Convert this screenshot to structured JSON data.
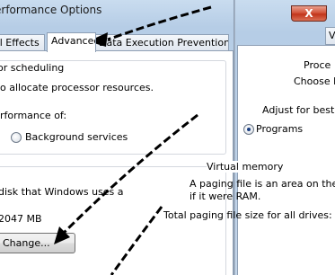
{
  "left_dialog": {
    "title": "erformance Options",
    "tabs": [
      {
        "label": "al Effects",
        "active": false
      },
      {
        "label": "Advanced",
        "active": true
      },
      {
        "label": "Data Execution Prevention",
        "active": false
      }
    ],
    "scheduling": {
      "heading": "or scheduling",
      "description": "o allocate processor resources.",
      "performance_label": "rformance of:",
      "option_background": "Background services"
    },
    "virtual_memory": {
      "description": "disk that Windows uses a",
      "size": "2047 MB",
      "change_button": "Change..."
    }
  },
  "right_dialog": {
    "tab_label": "Vi",
    "processor_heading": "Proce",
    "processor_text": "Choose h",
    "adjust_text": "Adjust for best p",
    "option_programs": "Programs",
    "vm_heading": "Virtual memory",
    "vm_text_1": "A paging file is an area on the har",
    "vm_text_2": "if it were RAM.",
    "vm_total": "Total paging file size for all drives:",
    "close_label": "X"
  },
  "colors": {
    "title_bar": "#b6cde6",
    "close_button": "#c2341a",
    "arrow": "#000000"
  }
}
